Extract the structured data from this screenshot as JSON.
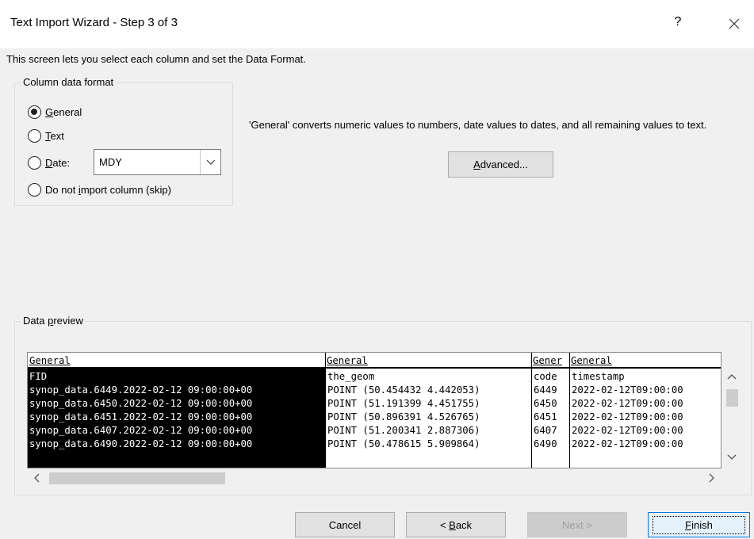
{
  "window": {
    "title": "Text Import Wizard - Step 3 of 3",
    "help": "?"
  },
  "intro": "This screen lets you select each column and set the Data Format.",
  "column_format": {
    "legend": "Column data format",
    "general": {
      "prefix": "",
      "accel": "G",
      "rest": "eneral"
    },
    "text": {
      "prefix": "",
      "accel": "T",
      "rest": "ext"
    },
    "date": {
      "prefix": "",
      "accel": "D",
      "rest": "ate:"
    },
    "skip": {
      "prefix": "Do not ",
      "accel": "i",
      "rest": "mport column (skip)"
    },
    "date_value": "MDY",
    "selected": "general"
  },
  "description": "'General' converts numeric values to numbers, date values to dates, and all remaining values to text.",
  "advanced": {
    "accel": "A",
    "rest": "dvanced..."
  },
  "preview": {
    "legend_prefix": "Data ",
    "legend_accel": "p",
    "legend_rest": "review",
    "headers": [
      "General",
      "General",
      "Gener",
      "General"
    ],
    "rows": [
      [
        "FID",
        "the_geom",
        "code",
        "timestamp"
      ],
      [
        "synop_data.6449.2022-02-12 09:00:00+00",
        "POINT (50.454432 4.442053)",
        "6449",
        "2022-02-12T09:00:00"
      ],
      [
        "synop_data.6450.2022-02-12 09:00:00+00",
        "POINT (51.191399 4.451755)",
        "6450",
        "2022-02-12T09:00:00"
      ],
      [
        "synop_data.6451.2022-02-12 09:00:00+00",
        "POINT (50.896391 4.526765)",
        "6451",
        "2022-02-12T09:00:00"
      ],
      [
        "synop_data.6407.2022-02-12 09:00:00+00",
        "POINT (51.200341 2.887306)",
        "6407",
        "2022-02-12T09:00:00"
      ],
      [
        "synop_data.6490.2022-02-12 09:00:00+00",
        "POINT (50.478615 5.909864)",
        "6490",
        "2022-02-12T09:00:00"
      ]
    ]
  },
  "buttons": {
    "cancel": "Cancel",
    "back": {
      "prefix": "< ",
      "accel": "B",
      "rest": "ack"
    },
    "next": "Next >",
    "finish": {
      "accel": "F",
      "rest": "inish"
    }
  }
}
